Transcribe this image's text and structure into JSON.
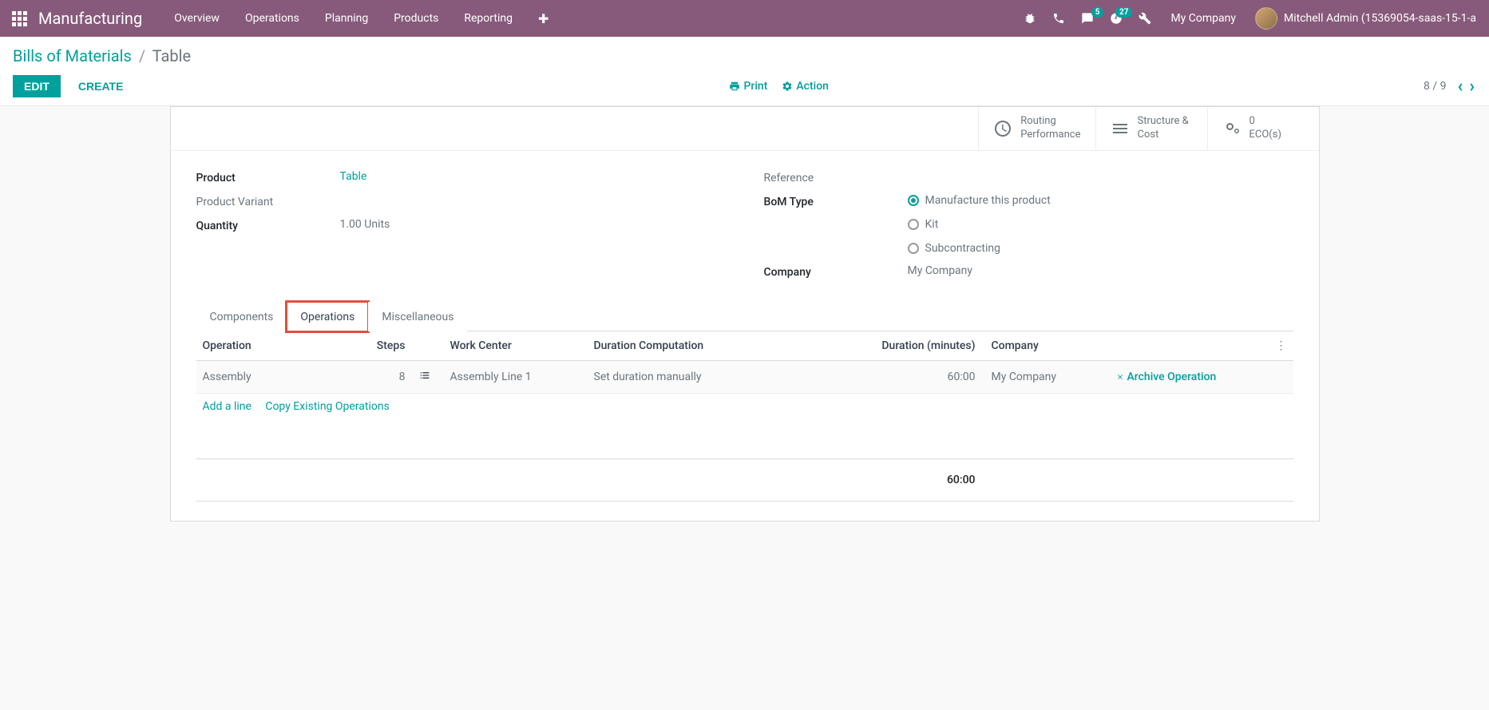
{
  "nav": {
    "brand": "Manufacturing",
    "items": [
      "Overview",
      "Operations",
      "Planning",
      "Products",
      "Reporting"
    ],
    "msg_badge": "5",
    "activity_badge": "27",
    "company": "My Company",
    "user": "Mitchell Admin (15369054-saas-15-1-a"
  },
  "breadcrumb": {
    "parent": "Bills of Materials",
    "current": "Table"
  },
  "buttons": {
    "edit": "Edit",
    "create": "Create",
    "print": "Print",
    "action": "Action"
  },
  "pager": {
    "pos": "8 / 9"
  },
  "stats": {
    "routing": [
      "Routing",
      "Performance"
    ],
    "structure": [
      "Structure &",
      "Cost"
    ],
    "eco_count": "0",
    "eco_label": "ECO(s)"
  },
  "form": {
    "product_label": "Product",
    "product_value": "Table",
    "variant_label": "Product Variant",
    "qty_label": "Quantity",
    "qty_value": "1.00",
    "qty_unit": "Units",
    "ref_label": "Reference",
    "bom_label": "BoM Type",
    "bom_options": [
      "Manufacture this product",
      "Kit",
      "Subcontracting"
    ],
    "bom_selected": 0,
    "company_label": "Company",
    "company_value": "My Company"
  },
  "tabs": [
    "Components",
    "Operations",
    "Miscellaneous"
  ],
  "active_tab": 1,
  "table": {
    "headers": {
      "op": "Operation",
      "steps": "Steps",
      "wc": "Work Center",
      "dc": "Duration Computation",
      "dur": "Duration (minutes)",
      "comp": "Company"
    },
    "row": {
      "op": "Assembly",
      "steps": "8",
      "wc": "Assembly Line 1",
      "dc": "Set duration manually",
      "dur": "60:00",
      "comp": "My Company",
      "archive": "Archive Operation"
    },
    "add": "Add a line",
    "copy": "Copy Existing Operations",
    "total": "60:00"
  }
}
